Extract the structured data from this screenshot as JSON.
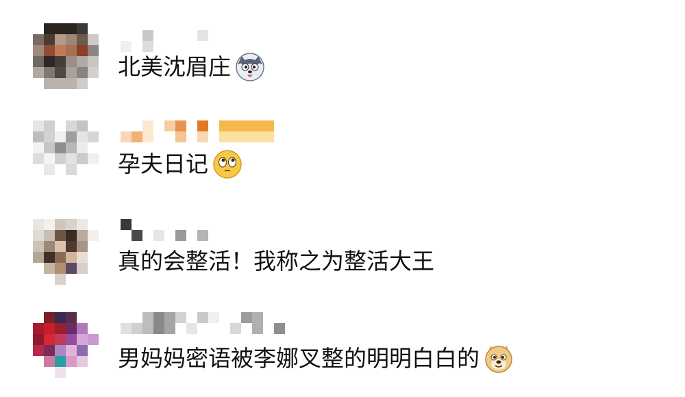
{
  "comments": [
    {
      "text": "北美沈眉庄",
      "emoji": "husky-face-icon"
    },
    {
      "text": "孕夫日记",
      "emoji": "flushed-face-icon"
    },
    {
      "text": "真的会整活！我称之为整活大王",
      "emoji": ""
    },
    {
      "text": "男妈妈密语被李娜叉整的明明白白的",
      "emoji": "doge-face-icon"
    }
  ]
}
